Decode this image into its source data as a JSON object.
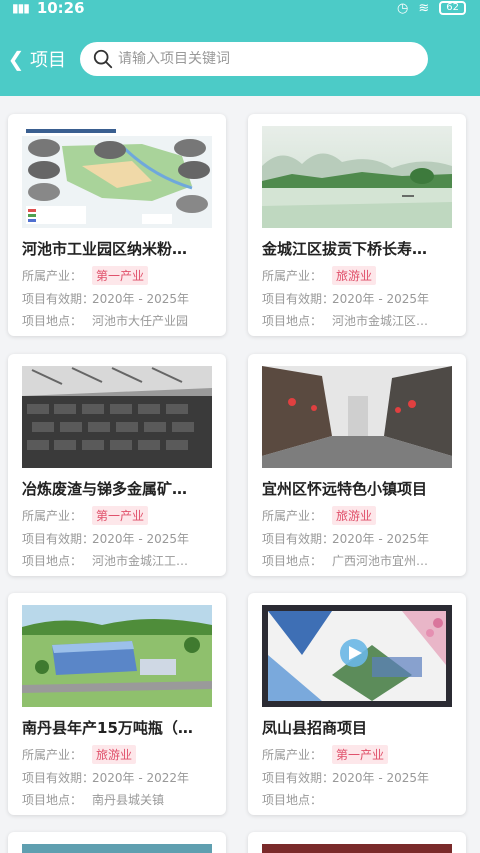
{
  "status": {
    "time": "10:26",
    "battery": "62"
  },
  "header": {
    "back_label": "项目",
    "search_placeholder": "请输入项目关键词"
  },
  "labels": {
    "industry": "所属产业：",
    "period": "项目有效期：",
    "location": "项目地点："
  },
  "colors": {
    "header": "#4ccbc7",
    "tag_bg": "#fde7ea",
    "tag_text": "#e0506a"
  },
  "projects": [
    {
      "title": "河池市工业园区纳米粉…",
      "industry": "第一产业",
      "period": "2020年 - 2025年",
      "location": "河池市大任产业园",
      "image": "industrial-park-map"
    },
    {
      "title": "金城江区拔贡下桥长寿…",
      "industry": "旅游业",
      "period": "2020年 - 2025年",
      "location": "河池市金城江区…",
      "image": "river-landscape"
    },
    {
      "title": "冶炼废渣与锑多金属矿…",
      "industry": "第一产业",
      "period": "2020年 - 2025年",
      "location": "河池市金城江工…",
      "image": "smelter-ingots"
    },
    {
      "title": "宜州区怀远特色小镇项目",
      "industry": "旅游业",
      "period": "2020年 - 2025年",
      "location": "广西河池市宜州…",
      "image": "old-town-street"
    },
    {
      "title": "南丹县年产15万吨瓶（…",
      "industry": "旅游业",
      "period": "2020年 - 2022年",
      "location": "南丹县城关镇",
      "image": "factory-rendering"
    },
    {
      "title": "凤山县招商项目",
      "industry": "第一产业",
      "period": "2020年 - 2025年",
      "location": "",
      "image": "tourism-video"
    }
  ]
}
